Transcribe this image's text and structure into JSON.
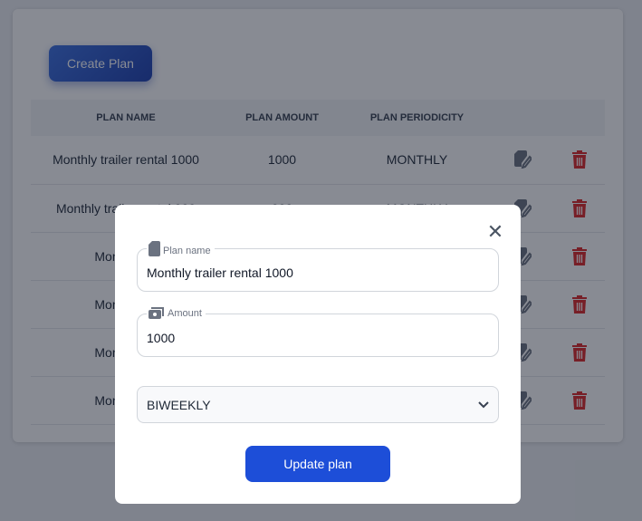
{
  "page": {
    "create_label": "Create Plan"
  },
  "table": {
    "headers": [
      "PLAN NAME",
      "PLAN AMOUNT",
      "PLAN PERIODICITY"
    ],
    "rows": [
      {
        "name": "Monthly trailer rental 1000",
        "amount": "1000",
        "periodicity": "MONTHLY"
      },
      {
        "name": "Monthly trailer rental 900",
        "amount": "900",
        "periodicity": "MONTHLY"
      },
      {
        "name": "Monthly tra",
        "amount": "",
        "periodicity": ""
      },
      {
        "name": "Monthly tra",
        "amount": "",
        "periodicity": ""
      },
      {
        "name": "Monthly tra",
        "amount": "",
        "periodicity": ""
      },
      {
        "name": "Monthly tra",
        "amount": "",
        "periodicity": ""
      }
    ],
    "icons": {
      "edit": "edit-document-icon",
      "delete": "trash-icon"
    },
    "delete_color": "#dc2626"
  },
  "modal": {
    "name_label": "Plan name",
    "name_value": "Monthly trailer rental 1000",
    "amount_label": "Amount",
    "amount_value": "1000",
    "periodicity_value": "BIWEEKLY",
    "submit_label": "Update plan",
    "accent": "#1d4ed8"
  }
}
